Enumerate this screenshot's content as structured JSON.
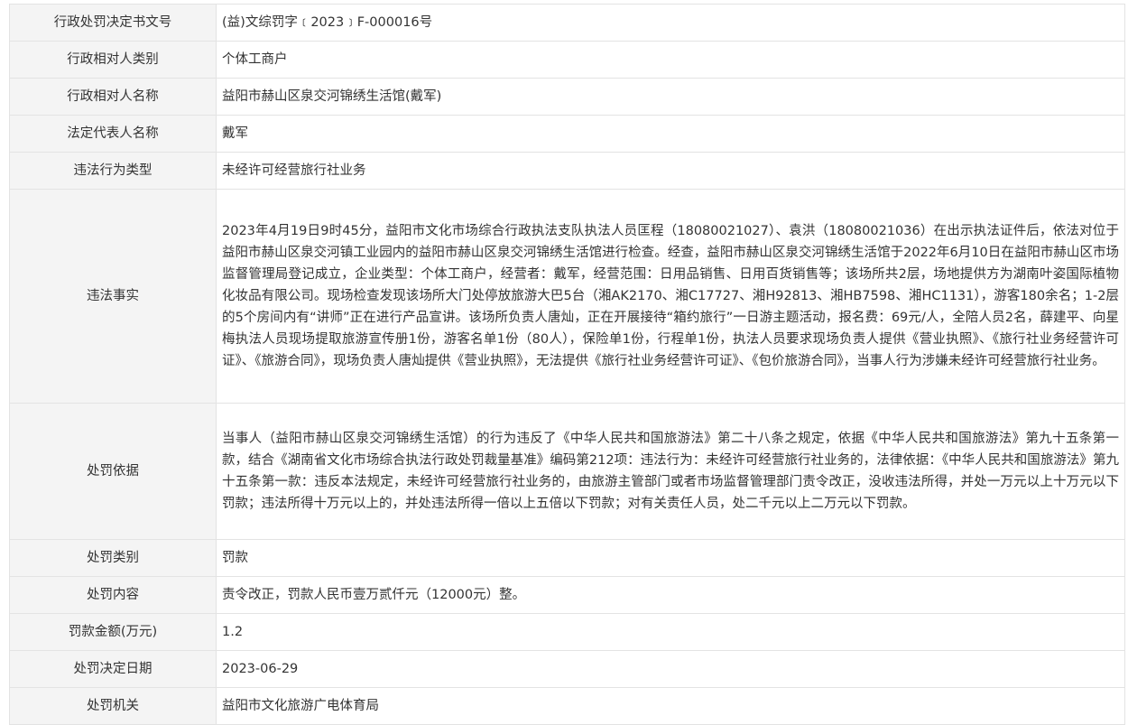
{
  "rows": [
    {
      "label": "行政处罚决定书文号",
      "value": "(益)文综罚字﹝2023﹞F-000016号"
    },
    {
      "label": "行政相对人类别",
      "value": "个体工商户"
    },
    {
      "label": "行政相对人名称",
      "value": "益阳市赫山区泉交河锦绣生活馆(戴军)"
    },
    {
      "label": "法定代表人名称",
      "value": "戴军"
    },
    {
      "label": "违法行为类型",
      "value": "未经许可经营旅行社业务"
    },
    {
      "label": "违法事实",
      "value": "2023年4月19日9时45分，益阳市文化市场综合行政执法支队执法人员匡程（18080021027）、袁洪（18080021036）在出示执法证件后，依法对位于益阳市赫山区泉交河镇工业园内的益阳市赫山区泉交河锦绣生活馆进行检查。经查，益阳市赫山区泉交河锦绣生活馆于2022年6月10日在益阳市赫山区市场监督管理局登记成立，企业类型：个体工商户，经营者：戴军，经营范围：日用品销售、日用百货销售等；该场所共2层，场地提供方为湖南叶姿国际植物化妆品有限公司。现场检查发现该场所大门处停放旅游大巴5台（湘AK2170、湘C17727、湘H92813、湘HB7598、湘HC1131），游客180余名；1-2层的5个房间内有“讲师”正在进行产品宣讲。该场所负责人唐灿，正在开展接待“箱约旅行”一日游主题活动，报名费：69元/人，全陪人员2名，薛建平、向星梅执法人员现场提取旅游宣传册1份，游客名单1份（80人），保险单1份，行程单1份，执法人员要求现场负责人提供《营业执照》、《旅行社业务经营许可证》、《旅游合同》，现场负责人唐灿提供《营业执照》，无法提供《旅行社业务经营许可证》、《包价旅游合同》，当事人行为涉嫌未经许可经营旅行社业务。"
    },
    {
      "label": "处罚依据",
      "value": "当事人（益阳市赫山区泉交河锦绣生活馆）的行为违反了《中华人民共和国旅游法》第二十八条之规定，依据《中华人民共和国旅游法》第九十五条第一款，结合《湖南省文化市场综合执法行政处罚裁量基准》编码第212项：违法行为：未经许可经营旅行社业务的，法律依据：《中华人民共和国旅游法》第九十五条第一款：违反本法规定，未经许可经营旅行社业务的，由旅游主管部门或者市场监督管理部门责令改正，没收违法所得，并处一万元以上十万元以下罚款；违法所得十万元以上的，并处违法所得一倍以上五倍以下罚款；对有关责任人员，处二千元以上二万元以下罚款。"
    },
    {
      "label": "处罚类别",
      "value": "罚款"
    },
    {
      "label": "处罚内容",
      "value": "责令改正，罚款人民币壹万贰仟元（12000元）整。"
    },
    {
      "label": "罚款金额(万元)",
      "value": "1.2"
    },
    {
      "label": "处罚决定日期",
      "value": "2023-06-29"
    },
    {
      "label": "处罚机关",
      "value": "益阳市文化旅游广电体育局"
    }
  ]
}
